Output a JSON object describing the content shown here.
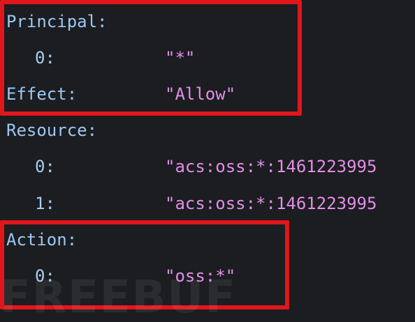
{
  "policy": {
    "principal": {
      "key": "Principal:",
      "items": [
        {
          "index": "0:",
          "value": "\"*\""
        }
      ]
    },
    "effect": {
      "key": "Effect:",
      "value": "\"Allow\""
    },
    "resource": {
      "key": "Resource:",
      "items": [
        {
          "index": "0:",
          "value": "\"acs:oss:*:1461223995"
        },
        {
          "index": "1:",
          "value": "\"acs:oss:*:1461223995"
        }
      ]
    },
    "action": {
      "key": "Action:",
      "items": [
        {
          "index": "0:",
          "value": "\"oss:*\""
        }
      ]
    }
  },
  "highlights": {
    "color": "#e0161b",
    "boxes": [
      "principal-effect-highlight",
      "action-highlight"
    ]
  },
  "watermark": {
    "text": "FREEBUF"
  },
  "colors": {
    "background": "#1b1d21",
    "key": "#9cc8f2",
    "string_value": "#e48de6"
  }
}
